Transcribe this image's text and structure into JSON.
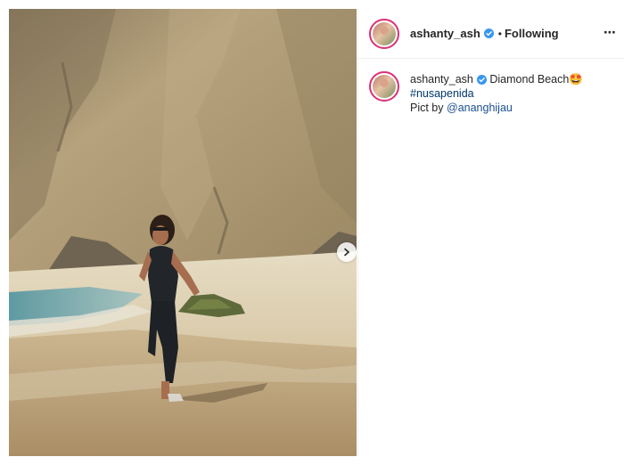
{
  "post": {
    "username": "ashanty_ash",
    "follow_state": "Following",
    "separator": "•",
    "more_icon": "⋯"
  },
  "caption": {
    "username": "ashanty_ash",
    "text": "Diamond Beach",
    "emoji": "🤩",
    "hashtag": "#nusapenida",
    "credit_prefix": "Pict by",
    "mention": "@ananghijau"
  },
  "colors": {
    "verified": "#3897f0",
    "hashtag": "#00376b",
    "avatar_ring": "#d93175"
  },
  "icons": {
    "verified": "verified-badge-icon",
    "next": "chevron-right-icon",
    "more": "more-options-icon"
  }
}
